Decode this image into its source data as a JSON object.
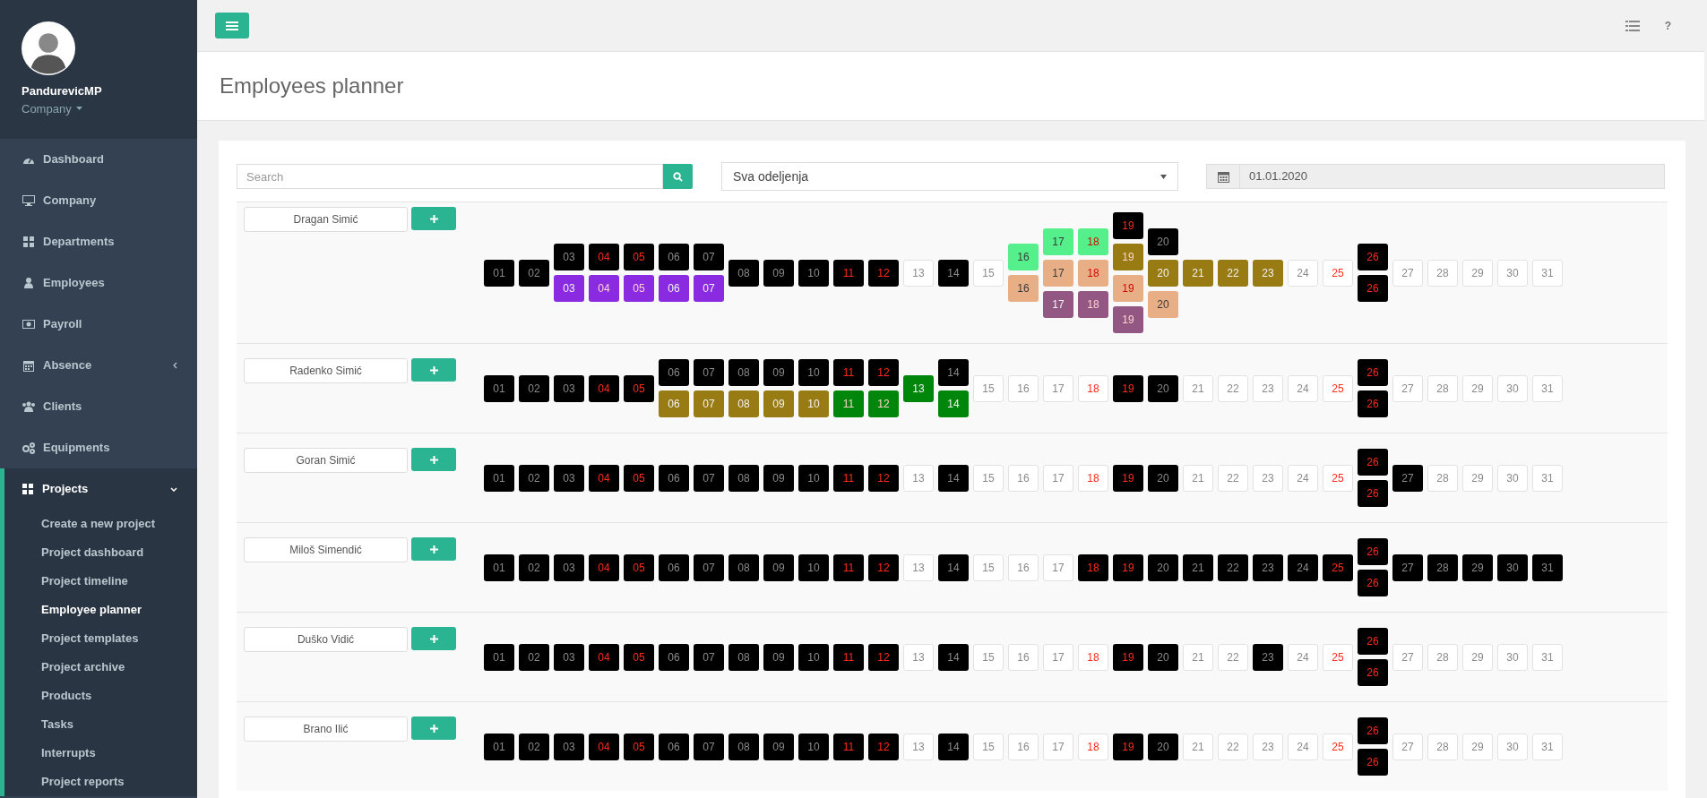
{
  "sidebar": {
    "user": {
      "name": "PandurevicMP",
      "company": "Company"
    },
    "items": [
      {
        "label": "Dashboard",
        "kind": "link"
      },
      {
        "label": "Company",
        "kind": "link"
      },
      {
        "label": "Departments",
        "kind": "link"
      },
      {
        "label": "Employees",
        "kind": "link"
      },
      {
        "label": "Payroll",
        "kind": "link"
      },
      {
        "label": "Absence",
        "kind": "group",
        "expanded": false
      },
      {
        "label": "Clients",
        "kind": "link"
      },
      {
        "label": "Equipments",
        "kind": "link"
      },
      {
        "label": "Projects",
        "kind": "group",
        "expanded": true,
        "children": [
          {
            "label": "Create a new project",
            "selected": false
          },
          {
            "label": "Project dashboard",
            "selected": false
          },
          {
            "label": "Project timeline",
            "selected": false
          },
          {
            "label": "Employee planner",
            "selected": true
          },
          {
            "label": "Project templates",
            "selected": false
          },
          {
            "label": "Project archive",
            "selected": false
          },
          {
            "label": "Products",
            "selected": false
          },
          {
            "label": "Tasks",
            "selected": false
          },
          {
            "label": "Interrupts",
            "selected": false
          },
          {
            "label": "Project reports",
            "selected": false
          }
        ]
      }
    ]
  },
  "topbar": {
    "help": "?"
  },
  "page_title": "Employees planner",
  "filters": {
    "search": {
      "placeholder": "Search"
    },
    "department": {
      "value": "Sva odeljenja"
    },
    "date": {
      "value": "01.01.2020"
    }
  },
  "employees": [
    {
      "name": "Dragan Simić",
      "days": [
        {
          "weekend": false,
          "blocks": [
            {
              "text": "01",
              "color": "#000000"
            }
          ]
        },
        {
          "weekend": false,
          "blocks": [
            {
              "text": "02",
              "color": "#000000"
            }
          ]
        },
        {
          "weekend": false,
          "blocks": [
            {
              "text": "03",
              "color": "#000000"
            },
            {
              "text": "03",
              "color": "#8a2be2"
            }
          ]
        },
        {
          "weekend": true,
          "blocks": [
            {
              "text": "04",
              "color": "#000000"
            },
            {
              "text": "04",
              "color": "#8a2be2"
            }
          ]
        },
        {
          "weekend": true,
          "blocks": [
            {
              "text": "05",
              "color": "#000000"
            },
            {
              "text": "05",
              "color": "#8a2be2"
            }
          ]
        },
        {
          "weekend": false,
          "blocks": [
            {
              "text": "06",
              "color": "#000000"
            },
            {
              "text": "06",
              "color": "#8a2be2"
            }
          ]
        },
        {
          "weekend": false,
          "blocks": [
            {
              "text": "07",
              "color": "#000000"
            },
            {
              "text": "07",
              "color": "#8a2be2"
            }
          ]
        },
        {
          "weekend": false,
          "blocks": [
            {
              "text": "08",
              "color": "#000000"
            }
          ]
        },
        {
          "weekend": false,
          "blocks": [
            {
              "text": "09",
              "color": "#000000"
            }
          ]
        },
        {
          "weekend": false,
          "blocks": [
            {
              "text": "10",
              "color": "#000000"
            }
          ]
        },
        {
          "weekend": true,
          "blocks": [
            {
              "text": "11",
              "color": "#000000"
            }
          ]
        },
        {
          "weekend": true,
          "blocks": [
            {
              "text": "12",
              "color": "#000000"
            }
          ]
        },
        {
          "weekend": false,
          "blocks": [
            {
              "text": "13",
              "color": "#ffffff"
            }
          ]
        },
        {
          "weekend": false,
          "blocks": [
            {
              "text": "14",
              "color": "#000000"
            }
          ]
        },
        {
          "weekend": false,
          "blocks": [
            {
              "text": "15",
              "color": "#ffffff"
            }
          ]
        },
        {
          "weekend": false,
          "blocks": [
            {
              "text": "16",
              "color": "#55ef8b"
            },
            {
              "text": "16",
              "color": "#e8ae86"
            }
          ]
        },
        {
          "weekend": false,
          "blocks": [
            {
              "text": "17",
              "color": "#55ef8b"
            },
            {
              "text": "17",
              "color": "#e8ae86"
            },
            {
              "text": "17",
              "color": "#925783"
            }
          ]
        },
        {
          "weekend": true,
          "blocks": [
            {
              "text": "18",
              "color": "#55ef8b"
            },
            {
              "text": "18",
              "color": "#e8ae86"
            },
            {
              "text": "18",
              "color": "#925783"
            }
          ]
        },
        {
          "weekend": true,
          "blocks": [
            {
              "text": "19",
              "color": "#000000"
            },
            {
              "text": "19",
              "color": "#987b12"
            },
            {
              "text": "19",
              "color": "#e8ae86"
            },
            {
              "text": "19",
              "color": "#925783"
            }
          ]
        },
        {
          "weekend": false,
          "blocks": [
            {
              "text": "20",
              "color": "#000000"
            },
            {
              "text": "20",
              "color": "#987b12"
            },
            {
              "text": "20",
              "color": "#e8ae86"
            }
          ]
        },
        {
          "weekend": false,
          "blocks": [
            {
              "text": "21",
              "color": "#987b12"
            }
          ]
        },
        {
          "weekend": false,
          "blocks": [
            {
              "text": "22",
              "color": "#987b12"
            }
          ]
        },
        {
          "weekend": false,
          "blocks": [
            {
              "text": "23",
              "color": "#987b12"
            }
          ]
        },
        {
          "weekend": false,
          "blocks": [
            {
              "text": "24",
              "color": "#ffffff"
            }
          ]
        },
        {
          "weekend": true,
          "blocks": [
            {
              "text": "25",
              "color": "#ffffff"
            }
          ]
        },
        {
          "weekend": true,
          "blocks": [
            {
              "text": "26",
              "color": "#000000"
            },
            {
              "text": "26",
              "color": "#000000"
            }
          ]
        },
        {
          "weekend": false,
          "blocks": [
            {
              "text": "27",
              "color": "#ffffff"
            }
          ]
        },
        {
          "weekend": false,
          "blocks": [
            {
              "text": "28",
              "color": "#ffffff"
            }
          ]
        },
        {
          "weekend": false,
          "blocks": [
            {
              "text": "29",
              "color": "#ffffff"
            }
          ]
        },
        {
          "weekend": false,
          "blocks": [
            {
              "text": "30",
              "color": "#ffffff"
            }
          ]
        },
        {
          "weekend": false,
          "blocks": [
            {
              "text": "31",
              "color": "#ffffff"
            }
          ]
        }
      ]
    },
    {
      "name": "Radenko Simić",
      "days": [
        {
          "weekend": false,
          "blocks": [
            {
              "text": "01",
              "color": "#000000"
            }
          ]
        },
        {
          "weekend": false,
          "blocks": [
            {
              "text": "02",
              "color": "#000000"
            }
          ]
        },
        {
          "weekend": false,
          "blocks": [
            {
              "text": "03",
              "color": "#000000"
            }
          ]
        },
        {
          "weekend": true,
          "blocks": [
            {
              "text": "04",
              "color": "#000000"
            }
          ]
        },
        {
          "weekend": true,
          "blocks": [
            {
              "text": "05",
              "color": "#000000"
            }
          ]
        },
        {
          "weekend": false,
          "blocks": [
            {
              "text": "06",
              "color": "#000000"
            },
            {
              "text": "06",
              "color": "#987b12"
            }
          ]
        },
        {
          "weekend": false,
          "blocks": [
            {
              "text": "07",
              "color": "#000000"
            },
            {
              "text": "07",
              "color": "#987b12"
            }
          ]
        },
        {
          "weekend": false,
          "blocks": [
            {
              "text": "08",
              "color": "#000000"
            },
            {
              "text": "08",
              "color": "#987b12"
            }
          ]
        },
        {
          "weekend": false,
          "blocks": [
            {
              "text": "09",
              "color": "#000000"
            },
            {
              "text": "09",
              "color": "#987b12"
            }
          ]
        },
        {
          "weekend": false,
          "blocks": [
            {
              "text": "10",
              "color": "#000000"
            },
            {
              "text": "10",
              "color": "#987b12"
            }
          ]
        },
        {
          "weekend": true,
          "blocks": [
            {
              "text": "11",
              "color": "#000000"
            },
            {
              "text": "11",
              "color": "#00870b"
            }
          ]
        },
        {
          "weekend": true,
          "blocks": [
            {
              "text": "12",
              "color": "#000000"
            },
            {
              "text": "12",
              "color": "#00870b"
            }
          ]
        },
        {
          "weekend": false,
          "blocks": [
            {
              "text": "13",
              "color": "#00870b"
            }
          ]
        },
        {
          "weekend": false,
          "blocks": [
            {
              "text": "14",
              "color": "#000000"
            },
            {
              "text": "14",
              "color": "#00870b"
            }
          ]
        },
        {
          "weekend": false,
          "blocks": [
            {
              "text": "15",
              "color": "#ffffff"
            }
          ]
        },
        {
          "weekend": false,
          "blocks": [
            {
              "text": "16",
              "color": "#ffffff"
            }
          ]
        },
        {
          "weekend": false,
          "blocks": [
            {
              "text": "17",
              "color": "#ffffff"
            }
          ]
        },
        {
          "weekend": true,
          "blocks": [
            {
              "text": "18",
              "color": "#ffffff"
            }
          ]
        },
        {
          "weekend": true,
          "blocks": [
            {
              "text": "19",
              "color": "#000000"
            }
          ]
        },
        {
          "weekend": false,
          "blocks": [
            {
              "text": "20",
              "color": "#000000"
            }
          ]
        },
        {
          "weekend": false,
          "blocks": [
            {
              "text": "21",
              "color": "#ffffff"
            }
          ]
        },
        {
          "weekend": false,
          "blocks": [
            {
              "text": "22",
              "color": "#ffffff"
            }
          ]
        },
        {
          "weekend": false,
          "blocks": [
            {
              "text": "23",
              "color": "#ffffff"
            }
          ]
        },
        {
          "weekend": false,
          "blocks": [
            {
              "text": "24",
              "color": "#ffffff"
            }
          ]
        },
        {
          "weekend": true,
          "blocks": [
            {
              "text": "25",
              "color": "#ffffff"
            }
          ]
        },
        {
          "weekend": true,
          "blocks": [
            {
              "text": "26",
              "color": "#000000"
            },
            {
              "text": "26",
              "color": "#000000"
            }
          ]
        },
        {
          "weekend": false,
          "blocks": [
            {
              "text": "27",
              "color": "#ffffff"
            }
          ]
        },
        {
          "weekend": false,
          "blocks": [
            {
              "text": "28",
              "color": "#ffffff"
            }
          ]
        },
        {
          "weekend": false,
          "blocks": [
            {
              "text": "29",
              "color": "#ffffff"
            }
          ]
        },
        {
          "weekend": false,
          "blocks": [
            {
              "text": "30",
              "color": "#ffffff"
            }
          ]
        },
        {
          "weekend": false,
          "blocks": [
            {
              "text": "31",
              "color": "#ffffff"
            }
          ]
        }
      ]
    },
    {
      "name": "Goran Simić",
      "days": [
        {
          "weekend": false,
          "blocks": [
            {
              "text": "01",
              "color": "#000000"
            }
          ]
        },
        {
          "weekend": false,
          "blocks": [
            {
              "text": "02",
              "color": "#000000"
            }
          ]
        },
        {
          "weekend": false,
          "blocks": [
            {
              "text": "03",
              "color": "#000000"
            }
          ]
        },
        {
          "weekend": true,
          "blocks": [
            {
              "text": "04",
              "color": "#000000"
            }
          ]
        },
        {
          "weekend": true,
          "blocks": [
            {
              "text": "05",
              "color": "#000000"
            }
          ]
        },
        {
          "weekend": false,
          "blocks": [
            {
              "text": "06",
              "color": "#000000"
            }
          ]
        },
        {
          "weekend": false,
          "blocks": [
            {
              "text": "07",
              "color": "#000000"
            }
          ]
        },
        {
          "weekend": false,
          "blocks": [
            {
              "text": "08",
              "color": "#000000"
            }
          ]
        },
        {
          "weekend": false,
          "blocks": [
            {
              "text": "09",
              "color": "#000000"
            }
          ]
        },
        {
          "weekend": false,
          "blocks": [
            {
              "text": "10",
              "color": "#000000"
            }
          ]
        },
        {
          "weekend": true,
          "blocks": [
            {
              "text": "11",
              "color": "#000000"
            }
          ]
        },
        {
          "weekend": true,
          "blocks": [
            {
              "text": "12",
              "color": "#000000"
            }
          ]
        },
        {
          "weekend": false,
          "blocks": [
            {
              "text": "13",
              "color": "#ffffff"
            }
          ]
        },
        {
          "weekend": false,
          "blocks": [
            {
              "text": "14",
              "color": "#000000"
            }
          ]
        },
        {
          "weekend": false,
          "blocks": [
            {
              "text": "15",
              "color": "#ffffff"
            }
          ]
        },
        {
          "weekend": false,
          "blocks": [
            {
              "text": "16",
              "color": "#ffffff"
            }
          ]
        },
        {
          "weekend": false,
          "blocks": [
            {
              "text": "17",
              "color": "#ffffff"
            }
          ]
        },
        {
          "weekend": true,
          "blocks": [
            {
              "text": "18",
              "color": "#ffffff"
            }
          ]
        },
        {
          "weekend": true,
          "blocks": [
            {
              "text": "19",
              "color": "#000000"
            }
          ]
        },
        {
          "weekend": false,
          "blocks": [
            {
              "text": "20",
              "color": "#000000"
            }
          ]
        },
        {
          "weekend": false,
          "blocks": [
            {
              "text": "21",
              "color": "#ffffff"
            }
          ]
        },
        {
          "weekend": false,
          "blocks": [
            {
              "text": "22",
              "color": "#ffffff"
            }
          ]
        },
        {
          "weekend": false,
          "blocks": [
            {
              "text": "23",
              "color": "#ffffff"
            }
          ]
        },
        {
          "weekend": false,
          "blocks": [
            {
              "text": "24",
              "color": "#ffffff"
            }
          ]
        },
        {
          "weekend": true,
          "blocks": [
            {
              "text": "25",
              "color": "#ffffff"
            }
          ]
        },
        {
          "weekend": true,
          "blocks": [
            {
              "text": "26",
              "color": "#000000"
            },
            {
              "text": "26",
              "color": "#000000"
            }
          ]
        },
        {
          "weekend": false,
          "blocks": [
            {
              "text": "27",
              "color": "#000000"
            }
          ]
        },
        {
          "weekend": false,
          "blocks": [
            {
              "text": "28",
              "color": "#ffffff"
            }
          ]
        },
        {
          "weekend": false,
          "blocks": [
            {
              "text": "29",
              "color": "#ffffff"
            }
          ]
        },
        {
          "weekend": false,
          "blocks": [
            {
              "text": "30",
              "color": "#ffffff"
            }
          ]
        },
        {
          "weekend": false,
          "blocks": [
            {
              "text": "31",
              "color": "#ffffff"
            }
          ]
        }
      ]
    },
    {
      "name": "Miloš Simendić",
      "days": [
        {
          "weekend": false,
          "blocks": [
            {
              "text": "01",
              "color": "#000000"
            }
          ]
        },
        {
          "weekend": false,
          "blocks": [
            {
              "text": "02",
              "color": "#000000"
            }
          ]
        },
        {
          "weekend": false,
          "blocks": [
            {
              "text": "03",
              "color": "#000000"
            }
          ]
        },
        {
          "weekend": true,
          "blocks": [
            {
              "text": "04",
              "color": "#000000"
            }
          ]
        },
        {
          "weekend": true,
          "blocks": [
            {
              "text": "05",
              "color": "#000000"
            }
          ]
        },
        {
          "weekend": false,
          "blocks": [
            {
              "text": "06",
              "color": "#000000"
            }
          ]
        },
        {
          "weekend": false,
          "blocks": [
            {
              "text": "07",
              "color": "#000000"
            }
          ]
        },
        {
          "weekend": false,
          "blocks": [
            {
              "text": "08",
              "color": "#000000"
            }
          ]
        },
        {
          "weekend": false,
          "blocks": [
            {
              "text": "09",
              "color": "#000000"
            }
          ]
        },
        {
          "weekend": false,
          "blocks": [
            {
              "text": "10",
              "color": "#000000"
            }
          ]
        },
        {
          "weekend": true,
          "blocks": [
            {
              "text": "11",
              "color": "#000000"
            }
          ]
        },
        {
          "weekend": true,
          "blocks": [
            {
              "text": "12",
              "color": "#000000"
            }
          ]
        },
        {
          "weekend": false,
          "blocks": [
            {
              "text": "13",
              "color": "#ffffff"
            }
          ]
        },
        {
          "weekend": false,
          "blocks": [
            {
              "text": "14",
              "color": "#000000"
            }
          ]
        },
        {
          "weekend": false,
          "blocks": [
            {
              "text": "15",
              "color": "#ffffff"
            }
          ]
        },
        {
          "weekend": false,
          "blocks": [
            {
              "text": "16",
              "color": "#ffffff"
            }
          ]
        },
        {
          "weekend": false,
          "blocks": [
            {
              "text": "17",
              "color": "#ffffff"
            }
          ]
        },
        {
          "weekend": true,
          "blocks": [
            {
              "text": "18",
              "color": "#000000"
            }
          ]
        },
        {
          "weekend": true,
          "blocks": [
            {
              "text": "19",
              "color": "#000000"
            }
          ]
        },
        {
          "weekend": false,
          "blocks": [
            {
              "text": "20",
              "color": "#000000"
            }
          ]
        },
        {
          "weekend": false,
          "blocks": [
            {
              "text": "21",
              "color": "#000000"
            }
          ]
        },
        {
          "weekend": false,
          "blocks": [
            {
              "text": "22",
              "color": "#000000"
            }
          ]
        },
        {
          "weekend": false,
          "blocks": [
            {
              "text": "23",
              "color": "#000000"
            }
          ]
        },
        {
          "weekend": false,
          "blocks": [
            {
              "text": "24",
              "color": "#000000"
            }
          ]
        },
        {
          "weekend": true,
          "blocks": [
            {
              "text": "25",
              "color": "#000000"
            }
          ]
        },
        {
          "weekend": true,
          "blocks": [
            {
              "text": "26",
              "color": "#000000"
            },
            {
              "text": "26",
              "color": "#000000"
            }
          ]
        },
        {
          "weekend": false,
          "blocks": [
            {
              "text": "27",
              "color": "#000000"
            }
          ]
        },
        {
          "weekend": false,
          "blocks": [
            {
              "text": "28",
              "color": "#000000"
            }
          ]
        },
        {
          "weekend": false,
          "blocks": [
            {
              "text": "29",
              "color": "#000000"
            }
          ]
        },
        {
          "weekend": false,
          "blocks": [
            {
              "text": "30",
              "color": "#000000"
            }
          ]
        },
        {
          "weekend": false,
          "blocks": [
            {
              "text": "31",
              "color": "#000000"
            }
          ]
        }
      ]
    },
    {
      "name": "Duško Vidić",
      "days": [
        {
          "weekend": false,
          "blocks": [
            {
              "text": "01",
              "color": "#000000"
            }
          ]
        },
        {
          "weekend": false,
          "blocks": [
            {
              "text": "02",
              "color": "#000000"
            }
          ]
        },
        {
          "weekend": false,
          "blocks": [
            {
              "text": "03",
              "color": "#000000"
            }
          ]
        },
        {
          "weekend": true,
          "blocks": [
            {
              "text": "04",
              "color": "#000000"
            }
          ]
        },
        {
          "weekend": true,
          "blocks": [
            {
              "text": "05",
              "color": "#000000"
            }
          ]
        },
        {
          "weekend": false,
          "blocks": [
            {
              "text": "06",
              "color": "#000000"
            }
          ]
        },
        {
          "weekend": false,
          "blocks": [
            {
              "text": "07",
              "color": "#000000"
            }
          ]
        },
        {
          "weekend": false,
          "blocks": [
            {
              "text": "08",
              "color": "#000000"
            }
          ]
        },
        {
          "weekend": false,
          "blocks": [
            {
              "text": "09",
              "color": "#000000"
            }
          ]
        },
        {
          "weekend": false,
          "blocks": [
            {
              "text": "10",
              "color": "#000000"
            }
          ]
        },
        {
          "weekend": true,
          "blocks": [
            {
              "text": "11",
              "color": "#000000"
            }
          ]
        },
        {
          "weekend": true,
          "blocks": [
            {
              "text": "12",
              "color": "#000000"
            }
          ]
        },
        {
          "weekend": false,
          "blocks": [
            {
              "text": "13",
              "color": "#ffffff"
            }
          ]
        },
        {
          "weekend": false,
          "blocks": [
            {
              "text": "14",
              "color": "#000000"
            }
          ]
        },
        {
          "weekend": false,
          "blocks": [
            {
              "text": "15",
              "color": "#ffffff"
            }
          ]
        },
        {
          "weekend": false,
          "blocks": [
            {
              "text": "16",
              "color": "#ffffff"
            }
          ]
        },
        {
          "weekend": false,
          "blocks": [
            {
              "text": "17",
              "color": "#ffffff"
            }
          ]
        },
        {
          "weekend": true,
          "blocks": [
            {
              "text": "18",
              "color": "#ffffff"
            }
          ]
        },
        {
          "weekend": true,
          "blocks": [
            {
              "text": "19",
              "color": "#000000"
            }
          ]
        },
        {
          "weekend": false,
          "blocks": [
            {
              "text": "20",
              "color": "#000000"
            }
          ]
        },
        {
          "weekend": false,
          "blocks": [
            {
              "text": "21",
              "color": "#ffffff"
            }
          ]
        },
        {
          "weekend": false,
          "blocks": [
            {
              "text": "22",
              "color": "#ffffff"
            }
          ]
        },
        {
          "weekend": false,
          "blocks": [
            {
              "text": "23",
              "color": "#000000"
            }
          ]
        },
        {
          "weekend": false,
          "blocks": [
            {
              "text": "24",
              "color": "#ffffff"
            }
          ]
        },
        {
          "weekend": true,
          "blocks": [
            {
              "text": "25",
              "color": "#ffffff"
            }
          ]
        },
        {
          "weekend": true,
          "blocks": [
            {
              "text": "26",
              "color": "#000000"
            },
            {
              "text": "26",
              "color": "#000000"
            }
          ]
        },
        {
          "weekend": false,
          "blocks": [
            {
              "text": "27",
              "color": "#ffffff"
            }
          ]
        },
        {
          "weekend": false,
          "blocks": [
            {
              "text": "28",
              "color": "#ffffff"
            }
          ]
        },
        {
          "weekend": false,
          "blocks": [
            {
              "text": "29",
              "color": "#ffffff"
            }
          ]
        },
        {
          "weekend": false,
          "blocks": [
            {
              "text": "30",
              "color": "#ffffff"
            }
          ]
        },
        {
          "weekend": false,
          "blocks": [
            {
              "text": "31",
              "color": "#ffffff"
            }
          ]
        }
      ]
    },
    {
      "name": "Brano Ilić",
      "days": [
        {
          "weekend": false,
          "blocks": [
            {
              "text": "01",
              "color": "#000000"
            }
          ]
        },
        {
          "weekend": false,
          "blocks": [
            {
              "text": "02",
              "color": "#000000"
            }
          ]
        },
        {
          "weekend": false,
          "blocks": [
            {
              "text": "03",
              "color": "#000000"
            }
          ]
        },
        {
          "weekend": true,
          "blocks": [
            {
              "text": "04",
              "color": "#000000"
            }
          ]
        },
        {
          "weekend": true,
          "blocks": [
            {
              "text": "05",
              "color": "#000000"
            }
          ]
        },
        {
          "weekend": false,
          "blocks": [
            {
              "text": "06",
              "color": "#000000"
            }
          ]
        },
        {
          "weekend": false,
          "blocks": [
            {
              "text": "07",
              "color": "#000000"
            }
          ]
        },
        {
          "weekend": false,
          "blocks": [
            {
              "text": "08",
              "color": "#000000"
            }
          ]
        },
        {
          "weekend": false,
          "blocks": [
            {
              "text": "09",
              "color": "#000000"
            }
          ]
        },
        {
          "weekend": false,
          "blocks": [
            {
              "text": "10",
              "color": "#000000"
            }
          ]
        },
        {
          "weekend": true,
          "blocks": [
            {
              "text": "11",
              "color": "#000000"
            }
          ]
        },
        {
          "weekend": true,
          "blocks": [
            {
              "text": "12",
              "color": "#000000"
            }
          ]
        },
        {
          "weekend": false,
          "blocks": [
            {
              "text": "13",
              "color": "#ffffff"
            }
          ]
        },
        {
          "weekend": false,
          "blocks": [
            {
              "text": "14",
              "color": "#000000"
            }
          ]
        },
        {
          "weekend": false,
          "blocks": [
            {
              "text": "15",
              "color": "#ffffff"
            }
          ]
        },
        {
          "weekend": false,
          "blocks": [
            {
              "text": "16",
              "color": "#ffffff"
            }
          ]
        },
        {
          "weekend": false,
          "blocks": [
            {
              "text": "17",
              "color": "#ffffff"
            }
          ]
        },
        {
          "weekend": true,
          "blocks": [
            {
              "text": "18",
              "color": "#ffffff"
            }
          ]
        },
        {
          "weekend": true,
          "blocks": [
            {
              "text": "19",
              "color": "#000000"
            }
          ]
        },
        {
          "weekend": false,
          "blocks": [
            {
              "text": "20",
              "color": "#000000"
            }
          ]
        },
        {
          "weekend": false,
          "blocks": [
            {
              "text": "21",
              "color": "#ffffff"
            }
          ]
        },
        {
          "weekend": false,
          "blocks": [
            {
              "text": "22",
              "color": "#ffffff"
            }
          ]
        },
        {
          "weekend": false,
          "blocks": [
            {
              "text": "23",
              "color": "#ffffff"
            }
          ]
        },
        {
          "weekend": false,
          "blocks": [
            {
              "text": "24",
              "color": "#ffffff"
            }
          ]
        },
        {
          "weekend": true,
          "blocks": [
            {
              "text": "25",
              "color": "#ffffff"
            }
          ]
        },
        {
          "weekend": true,
          "blocks": [
            {
              "text": "26",
              "color": "#000000"
            },
            {
              "text": "26",
              "color": "#000000"
            }
          ]
        },
        {
          "weekend": false,
          "blocks": [
            {
              "text": "27",
              "color": "#ffffff"
            }
          ]
        },
        {
          "weekend": false,
          "blocks": [
            {
              "text": "28",
              "color": "#ffffff"
            }
          ]
        },
        {
          "weekend": false,
          "blocks": [
            {
              "text": "29",
              "color": "#ffffff"
            }
          ]
        },
        {
          "weekend": false,
          "blocks": [
            {
              "text": "30",
              "color": "#ffffff"
            }
          ]
        },
        {
          "weekend": false,
          "blocks": [
            {
              "text": "31",
              "color": "#ffffff"
            }
          ]
        }
      ]
    }
  ]
}
